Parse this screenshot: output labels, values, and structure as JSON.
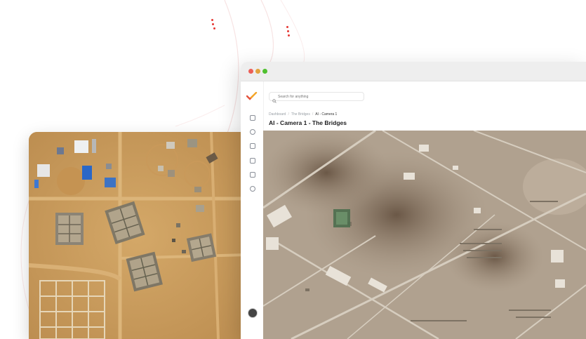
{
  "browser": {
    "window_controls": [
      "close",
      "minimize",
      "maximize"
    ],
    "colors": {
      "close": "#ec5f57",
      "minimize": "#e2a33f",
      "maximize": "#4fc02f"
    }
  },
  "sidebar": {
    "logo": "checkmark-logo-icon",
    "logo_colors": [
      "#e5533d",
      "#f4a62a"
    ],
    "icons": [
      "chart-icon",
      "user-icon",
      "file-icon",
      "grid-icon",
      "puzzle-icon",
      "chat-icon"
    ],
    "footer_avatar": "avatar-icon"
  },
  "search": {
    "placeholder": "Search for anything"
  },
  "breadcrumb": {
    "items": [
      "Dashboard",
      "The Bridges",
      "AI - Camera 1"
    ]
  },
  "page": {
    "title": "AI - Camera 1 - The Bridges"
  },
  "decor": {
    "accent": "#e53935",
    "arc_color": "#f6dede"
  }
}
